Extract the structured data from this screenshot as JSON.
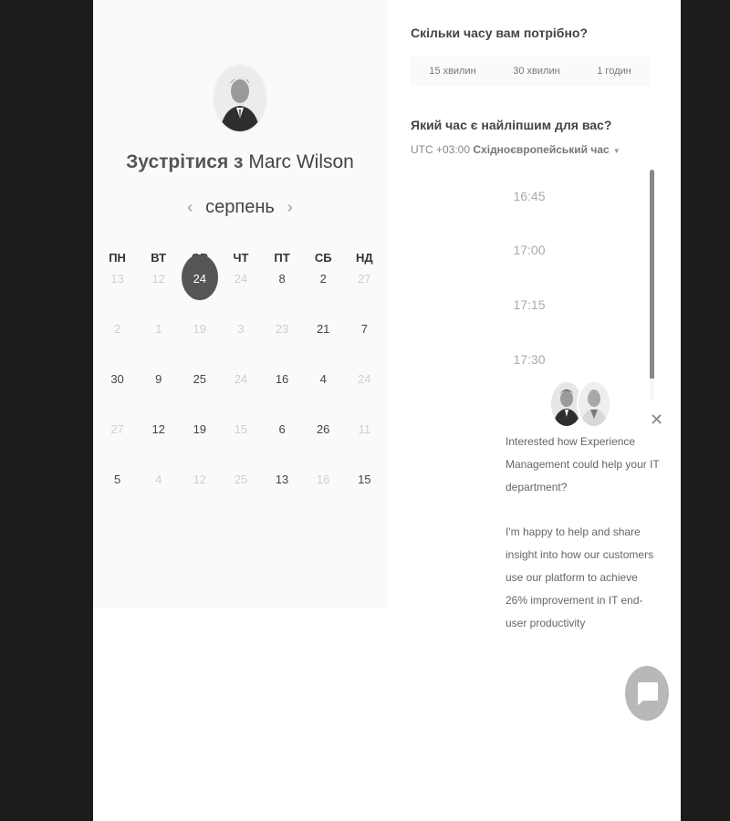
{
  "organizer": {
    "title_part1": "Зустрітися з",
    "title_part2": "Marc Wilson"
  },
  "calendar": {
    "month": "серпень",
    "weekdays": [
      "ПН",
      "ВТ",
      "СР",
      "ЧТ",
      "ПТ",
      "СБ",
      "НД"
    ],
    "weeks": [
      [
        {
          "d": "13",
          "a": false
        },
        {
          "d": "12",
          "a": false
        },
        {
          "d": "24",
          "a": true,
          "sel": true
        },
        {
          "d": "24",
          "a": false
        },
        {
          "d": "8",
          "a": true
        },
        {
          "d": "2",
          "a": true
        },
        {
          "d": "27",
          "a": false
        }
      ],
      [
        {
          "d": "2",
          "a": false
        },
        {
          "d": "1",
          "a": false
        },
        {
          "d": "19",
          "a": false
        },
        {
          "d": "3",
          "a": false
        },
        {
          "d": "23",
          "a": false
        },
        {
          "d": "21",
          "a": true
        },
        {
          "d": "7",
          "a": true
        }
      ],
      [
        {
          "d": "30",
          "a": true
        },
        {
          "d": "9",
          "a": true
        },
        {
          "d": "25",
          "a": true
        },
        {
          "d": "24",
          "a": false
        },
        {
          "d": "16",
          "a": true
        },
        {
          "d": "4",
          "a": true
        },
        {
          "d": "24",
          "a": false
        }
      ],
      [
        {
          "d": "27",
          "a": false
        },
        {
          "d": "12",
          "a": true
        },
        {
          "d": "19",
          "a": true
        },
        {
          "d": "15",
          "a": false
        },
        {
          "d": "6",
          "a": true
        },
        {
          "d": "26",
          "a": true
        },
        {
          "d": "11",
          "a": false
        }
      ],
      [
        {
          "d": "5",
          "a": true
        },
        {
          "d": "4",
          "a": false
        },
        {
          "d": "12",
          "a": false
        },
        {
          "d": "25",
          "a": false
        },
        {
          "d": "13",
          "a": true
        },
        {
          "d": "16",
          "a": false
        },
        {
          "d": "15",
          "a": true
        }
      ]
    ]
  },
  "duration": {
    "question": "Скільки часу вам потрібно?",
    "options": [
      "15 хвилин",
      "30 хвилин",
      "1 годин"
    ]
  },
  "time": {
    "question": "Який час є найліпшим для вас?",
    "timezone_offset": "UTC +03:00",
    "timezone_name": "Східноєвропейський час",
    "slots": [
      "16:45",
      "17:00",
      "17:15",
      "17:30"
    ]
  },
  "chat": {
    "message_1": "Interested how Experience Management could help your IT department?",
    "message_2": "I'm happy to help and share insight into how our customers use our platform to achieve 26% improvement in IT end-user productivity"
  },
  "icons": {
    "prev": "chevron-left-icon",
    "next": "chevron-right-icon",
    "close": "close-icon",
    "chat": "chat-bubble-icon"
  }
}
